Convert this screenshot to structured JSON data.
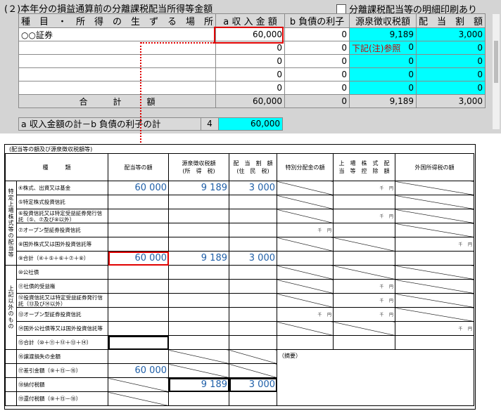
{
  "header": {
    "title": "(２)本年分の損益通算前の分離課税配当所得等金額",
    "print_detail_label": "分離課税配当等の明細印刷あり"
  },
  "table": {
    "columns": [
      "種　目　・　所　得　の　生　ず　る　場　所",
      "a 収 入 金 額",
      "b 負債の利子",
      "源泉徴収税額",
      "配　当　割　額"
    ],
    "rows": [
      {
        "name": "○○証券",
        "income": "60,000",
        "interest": "0",
        "withheld": "9,189",
        "allotment": "3,000",
        "note": ""
      },
      {
        "name": "",
        "income": "0",
        "interest": "0",
        "withheld": "0",
        "allotment": "0",
        "note": "下記(注)参照"
      },
      {
        "name": "",
        "income": "0",
        "interest": "0",
        "withheld": "0",
        "allotment": "0",
        "note": ""
      },
      {
        "name": "",
        "income": "0",
        "interest": "0",
        "withheld": "0",
        "allotment": "0",
        "note": ""
      },
      {
        "name": "",
        "income": "0",
        "interest": "0",
        "withheld": "0",
        "allotment": "0",
        "note": ""
      }
    ],
    "total": {
      "label": "合　　　計　　　額",
      "income": "60,000",
      "interest": "0",
      "withheld": "9,189",
      "allotment": "3,000"
    },
    "net": {
      "label": "a 収入金額の計－b 負債の利子の計",
      "no": "4",
      "value": "60,000"
    }
  },
  "form": {
    "title": "(配当等の額及び源泉徴収税額等)",
    "headers": [
      "種　　　類",
      "配当等の額",
      "源泉徴収税額\n(所　得　税)",
      "配　当　割　額\n(住　民　税)",
      "特別分配金の額",
      "上　場　株　式　配\n当　等　控　除　額",
      "外国所得税の額"
    ],
    "group1": "特定上場株式等の配当等",
    "group2": "上記以外のもの",
    "units": {
      "sen": "千",
      "en": "円"
    },
    "rows": [
      {
        "label": "④株式、出資又は基金",
        "amount": "60 000",
        "tax": "9 189",
        "res": "3 000"
      },
      {
        "label": "⑤特定株式投資信託",
        "amount": "",
        "tax": "",
        "res": ""
      },
      {
        "label": "⑥投資信託又は特定受益証券発行信託（⑤、⑦及び⑧以外）",
        "amount": "",
        "tax": "",
        "res": ""
      },
      {
        "label": "⑦オープン型証券投資信託",
        "amount": "",
        "tax": "",
        "res": ""
      },
      {
        "label": "⑧国外株式又は国外投資信託等",
        "amount": "",
        "tax": "",
        "res": ""
      },
      {
        "label": "⑨合計（④＋⑤＋⑥＋⑦＋⑧）",
        "amount": "60 000",
        "tax": "9 189",
        "res": "3 000"
      },
      {
        "label": "⑩公社債",
        "amount": "",
        "tax": "",
        "res": ""
      },
      {
        "label": "⑪社債的受益権",
        "amount": "",
        "tax": "",
        "res": ""
      },
      {
        "label": "⑫投資信託又は特定受益証券発行信託（⑬及び⑭以外）",
        "amount": "",
        "tax": "",
        "res": ""
      },
      {
        "label": "⑬オープン型証券投資信託",
        "amount": "",
        "tax": "",
        "res": ""
      },
      {
        "label": "⑭国外公社債等又は国外投資信託等",
        "amount": "",
        "tax": "",
        "res": ""
      },
      {
        "label": "⑮合計（⑩＋⑪＋⑫＋⑬＋⑭）",
        "amount": "",
        "tax": "",
        "res": ""
      }
    ],
    "bottom": [
      {
        "label": "⑯譲渡損失の金額",
        "value": ""
      },
      {
        "label": "⑰差引金額（⑨＋⑮－⑯）",
        "value": "60 000"
      },
      {
        "label": "⑱納付税額",
        "tax": "9 189",
        "res": "3 000"
      },
      {
        "label": "⑲還付税額（⑨＋⑮－⑱）",
        "value": ""
      }
    ],
    "remarks_label": "（摘要）"
  }
}
